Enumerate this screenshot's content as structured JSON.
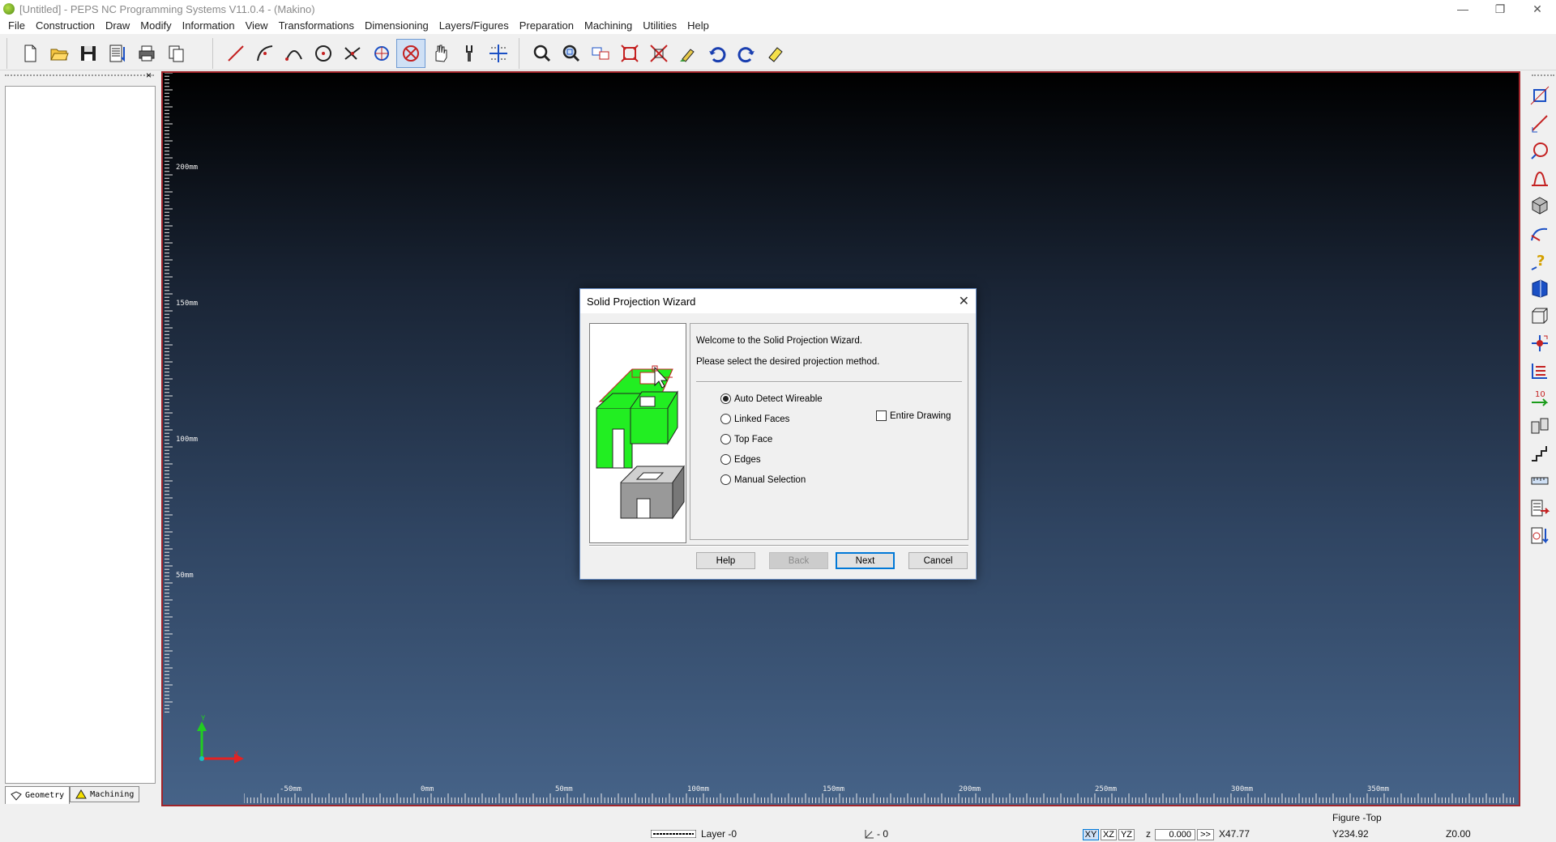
{
  "window": {
    "title": "[Untitled] - PEPS NC Programming Systems V11.0.4 - (Makino)",
    "icon": "app-logo-icon",
    "controls": [
      "minimize-icon",
      "restore-icon",
      "close-icon"
    ]
  },
  "menu": {
    "items": [
      "File",
      "Construction",
      "Draw",
      "Modify",
      "Information",
      "View",
      "Transformations",
      "Dimensioning",
      "Layers/Figures",
      "Preparation",
      "Machining",
      "Utilities",
      "Help"
    ]
  },
  "toolbar": {
    "active_tool": "cancel-select-icon",
    "icons": [
      "new-file-icon",
      "open-folder-icon",
      "save-icon",
      "nc-list-icon",
      "print-icon",
      "copy-icon",
      "line-icon",
      "arc-icon",
      "arc-three-point-icon",
      "circle-icon",
      "intersect-icon",
      "rotate-circle-icon",
      "cancel-select-icon",
      "pan-hand-icon",
      "tool-icon",
      "grid-icon",
      "zoom-icon",
      "zoom-window-icon",
      "view-layout-icon",
      "fit-screen-icon",
      "zoom-extents-icon",
      "brush-icon",
      "undo-icon",
      "redo-icon",
      "eraser-icon"
    ]
  },
  "left_panel": {
    "close": "×",
    "tabs": [
      {
        "label": "Geometry",
        "icon": "geometry-icon",
        "selected": true
      },
      {
        "label": "Machining",
        "icon": "machining-warning-icon",
        "selected": false
      }
    ]
  },
  "canvas": {
    "colors": {
      "border": "#a0242a",
      "top": "#000000",
      "bottom": "#466388"
    },
    "vertical_labels": [
      "200mm",
      "150mm",
      "100mm",
      "50mm"
    ],
    "horizontal_labels": [
      "-50mm",
      "0mm",
      "50mm",
      "100mm",
      "150mm",
      "200mm",
      "250mm",
      "300mm",
      "350mm"
    ],
    "axis": {
      "y_label": "Y",
      "x_label": "X",
      "y_color": "#22cc22",
      "x_color": "#e52222"
    }
  },
  "right_toolbar": {
    "icons": [
      "profile-icon",
      "line-measure-icon",
      "circle-point-icon",
      "bell-shape-icon",
      "cube-icon",
      "curve-icon",
      "help-question-icon",
      "solid-book-icon",
      "wireframe-box-icon",
      "move-point-icon",
      "stack-icon",
      "number-arrow-icon",
      "tools-copy-icon",
      "stairs-icon",
      "ruler-icon",
      "nc-export-icon",
      "cycle-down-icon"
    ]
  },
  "dialog": {
    "title": "Solid Projection Wizard",
    "welcome": "Welcome to the Solid Projection Wizard.",
    "instruction": "Please select the desired projection method.",
    "options": [
      {
        "label": "Auto Detect Wireable",
        "selected": true
      },
      {
        "label": "Linked Faces",
        "selected": false
      },
      {
        "label": "Top Face",
        "selected": false
      },
      {
        "label": "Edges",
        "selected": false
      },
      {
        "label": "Manual Selection",
        "selected": false
      }
    ],
    "entire_drawing": {
      "label": "Entire Drawing",
      "checked": false
    },
    "buttons": {
      "help": "Help",
      "back": "Back",
      "next": "Next",
      "cancel": "Cancel"
    }
  },
  "status": {
    "layer": "Layer -0",
    "counter": "- 0",
    "planes": [
      "XY",
      "XZ",
      "YZ"
    ],
    "z_label": "z",
    "z_value": "0.000",
    "advance": ">>",
    "x": "X47.77",
    "figure": "Figure -Top",
    "y": "Y234.92",
    "z": "Z0.00"
  }
}
